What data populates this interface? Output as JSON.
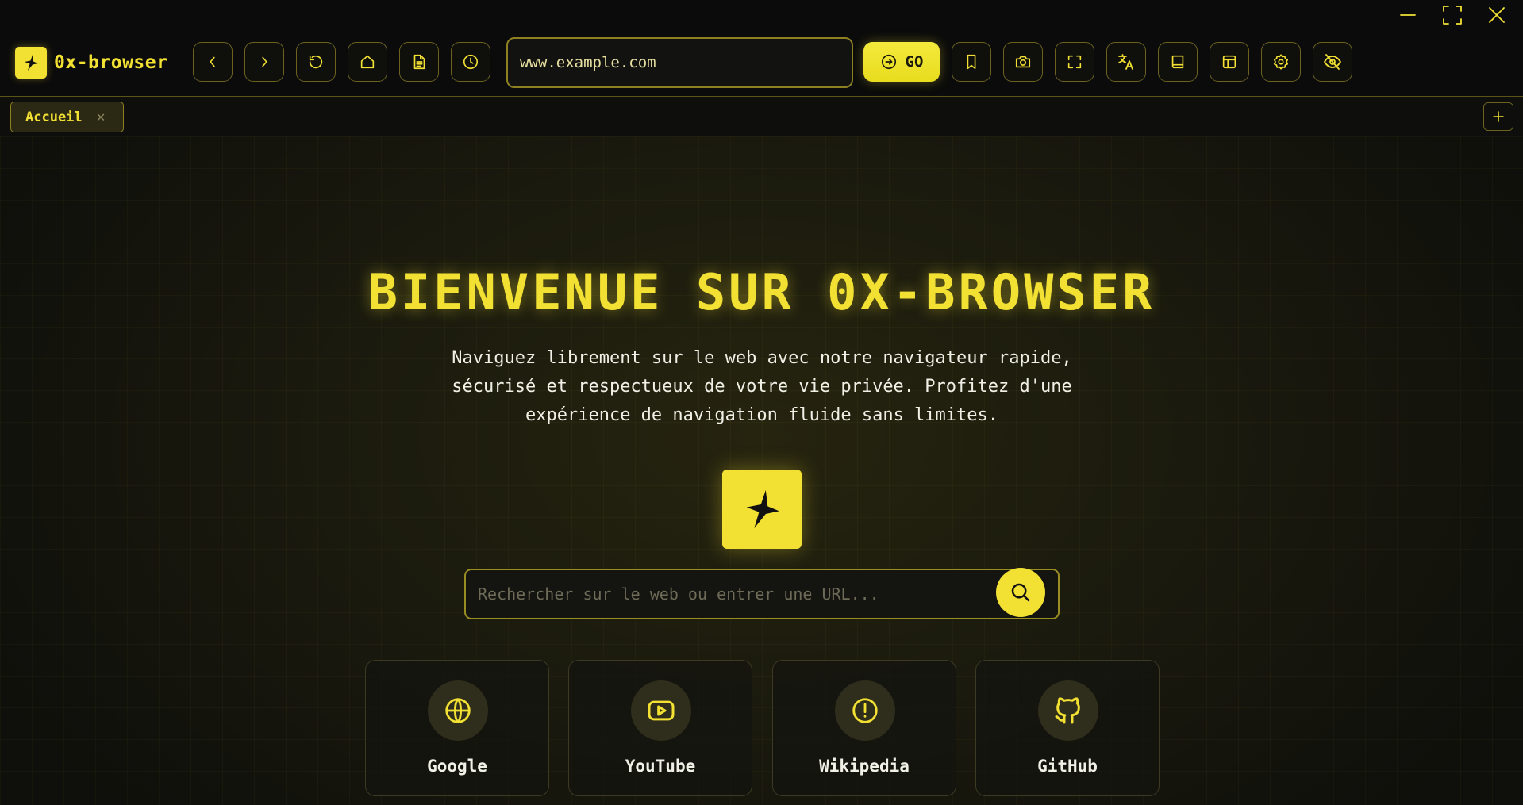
{
  "app": {
    "name": "0x-browser"
  },
  "window_controls": [
    "minimize-icon",
    "maximize-icon",
    "close-icon"
  ],
  "toolbar": {
    "nav_icons": [
      "chevron-left-icon",
      "chevron-right-icon",
      "reload-icon",
      "home-icon",
      "document-icon",
      "history-icon"
    ],
    "url_value": "www.example.com",
    "go_label": "GO",
    "tool_icons": [
      "bookmark-icon",
      "camera-icon",
      "fullscreen-icon",
      "translate-icon",
      "book-icon",
      "layout-icon",
      "gear-icon",
      "eye-off-icon"
    ]
  },
  "tabs": [
    {
      "label": "Accueil",
      "close": "✕"
    }
  ],
  "new_tab": "+",
  "hero": {
    "title": "BIENVENUE SUR 0X-BROWSER",
    "subtitle": "Naviguez librement sur le web avec notre navigateur rapide, sécurisé et respectueux de votre vie privée. Profitez d'une expérience de navigation fluide sans limites."
  },
  "search": {
    "placeholder": "Rechercher sur le web ou entrer une URL..."
  },
  "quick_links": [
    {
      "label": "Google",
      "icon": "globe-icon"
    },
    {
      "label": "YouTube",
      "icon": "youtube-icon"
    },
    {
      "label": "Wikipedia",
      "icon": "info-icon"
    },
    {
      "label": "GitHub",
      "icon": "github-icon"
    }
  ],
  "colors": {
    "accent": "#f2e033",
    "background": "#0b0b0b",
    "text": "#f0f0e6"
  }
}
